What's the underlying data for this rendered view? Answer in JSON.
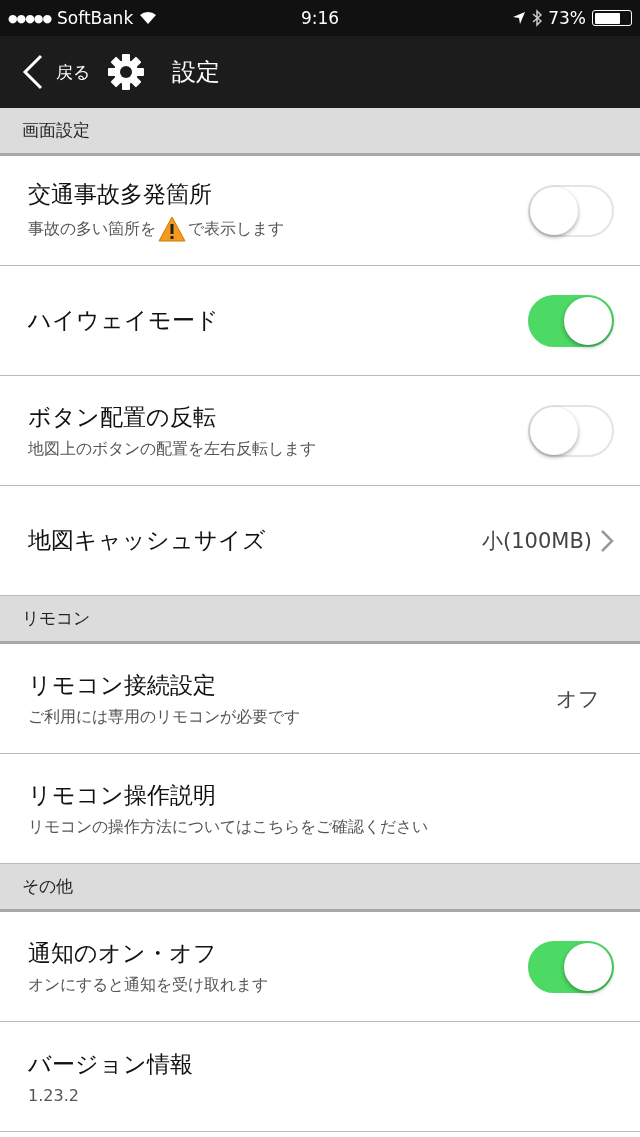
{
  "status_bar": {
    "signal": "●●●●●",
    "carrier": "SoftBank",
    "time": "9:16",
    "battery": "73%",
    "battery_meter": {
      "level": 0.73
    }
  },
  "nav": {
    "back": "戻る",
    "title": "設定"
  },
  "sections": [
    {
      "header": "画面設定",
      "rows": [
        {
          "kind": "toggle",
          "title": "交通事故多発箇所",
          "subtitle_before_icon": "事故の多い箇所を",
          "subtitle_after_icon": "で表示します",
          "on": false
        },
        {
          "kind": "toggle",
          "title": "ハイウェイモード",
          "on": true
        },
        {
          "kind": "toggle",
          "title": "ボタン配置の反転",
          "subtitle": "地図上のボタンの配置を左右反転します",
          "on": false
        },
        {
          "kind": "link",
          "title": "地図キャッシュサイズ",
          "value": "小(100MB)"
        }
      ]
    },
    {
      "header": "リモコン",
      "rows": [
        {
          "kind": "value",
          "title": "リモコン接続設定",
          "subtitle": "ご利用には専用のリモコンが必要です",
          "value": "オフ"
        },
        {
          "kind": "plain",
          "title": "リモコン操作説明",
          "subtitle": "リモコンの操作方法についてはこちらをご確認ください"
        }
      ]
    },
    {
      "header": "その他",
      "rows": [
        {
          "kind": "toggle",
          "title": "通知のオン・オフ",
          "subtitle": "オンにすると通知を受け取れます",
          "on": true
        },
        {
          "kind": "plain",
          "title": "バージョン情報",
          "subtitle": "1.23.2"
        }
      ]
    }
  ]
}
